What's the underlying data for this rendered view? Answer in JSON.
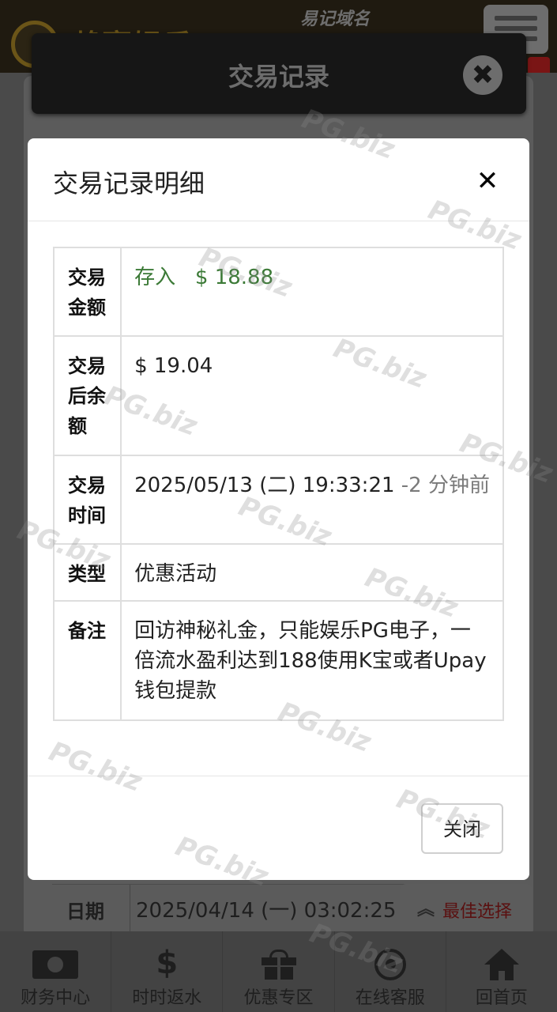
{
  "background": {
    "brand_name": "赖赢娱乐",
    "domain_label": "易记域名",
    "records_title": "交易记录",
    "date_row": {
      "label": "日期",
      "value": "2025/04/14 (一) 03:02:25 -"
    },
    "best_choice_label": "最佳选择",
    "watermark": "PG.biz"
  },
  "bottom_nav": [
    {
      "label": "财务中心",
      "icon": "money-icon"
    },
    {
      "label": "时时返水",
      "icon": "dollar-icon"
    },
    {
      "label": "优惠专区",
      "icon": "gift-icon"
    },
    {
      "label": "在线客服",
      "icon": "whatsapp-icon"
    },
    {
      "label": "回首页",
      "icon": "home-icon"
    }
  ],
  "modal": {
    "title": "交易记录明细",
    "close_button_label": "关闭",
    "rows": [
      {
        "key": "交易金额",
        "type": "存入",
        "amount": "$ 18.88"
      },
      {
        "key": "交易后余额",
        "value": "$ 19.04"
      },
      {
        "key": "交易时间",
        "value": "2025/05/13 (二) 19:33:21",
        "relative": "-2 分钟前"
      },
      {
        "key": "类型",
        "value": "优惠活动"
      },
      {
        "key": "备注",
        "value": "回访神秘礼金，只能娱乐PG电子，一倍流水盈利达到188使用K宝或者Upay钱包提款"
      }
    ]
  },
  "colors": {
    "deposit_green": "#3c7a37",
    "relative_time_gray": "#7a7a7a",
    "best_choice_red": "#5a1010"
  }
}
